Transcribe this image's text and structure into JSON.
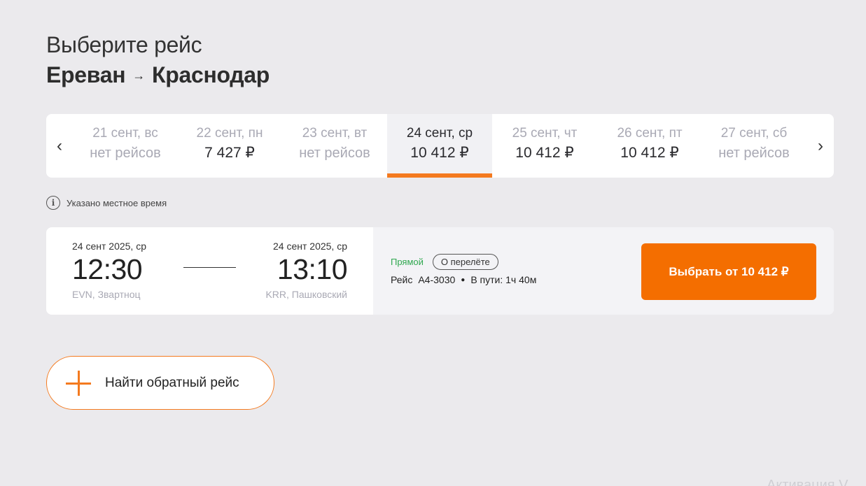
{
  "header": {
    "title": "Выберите рейс",
    "route_from": "Ереван",
    "route_arrow": "→",
    "route_to": "Краснодар"
  },
  "date_strip": {
    "prev_icon": "‹",
    "next_icon": "›",
    "days": [
      {
        "date": "21 сент, вс",
        "price": "нет рейсов",
        "available": false,
        "active": false
      },
      {
        "date": "22 сент, пн",
        "price": "7 427 ₽",
        "available": true,
        "active": false
      },
      {
        "date": "23 сент, вт",
        "price": "нет рейсов",
        "available": false,
        "active": false
      },
      {
        "date": "24 сент, ср",
        "price": "10 412 ₽",
        "available": true,
        "active": true
      },
      {
        "date": "25 сент, чт",
        "price": "10 412 ₽",
        "available": true,
        "active": false
      },
      {
        "date": "26 сент, пт",
        "price": "10 412 ₽",
        "available": true,
        "active": false
      },
      {
        "date": "27 сент, сб",
        "price": "нет рейсов",
        "available": false,
        "active": false
      }
    ]
  },
  "note": {
    "icon": "i",
    "text": "Указано местное время"
  },
  "flight": {
    "departure": {
      "date": "24 сент 2025, ср",
      "time": "12:30",
      "airport": "EVN, Звартноц"
    },
    "arrival": {
      "date": "24 сент 2025, ср",
      "time": "13:10",
      "airport": "KRR, Пашковский"
    },
    "type": "Прямой",
    "about_label": "О перелёте",
    "flight_label": "Рейс",
    "flight_number": "А4-3030",
    "duration": "В пути: 1ч 40м",
    "select_label": "Выбрать от 10 412 ₽"
  },
  "return_flight": {
    "label": "Найти обратный рейс"
  },
  "watermark": "Активация V",
  "colors": {
    "accent": "#f47a1f",
    "button": "#f46e00",
    "direct": "#2fa84f",
    "background": "#ebeaed"
  }
}
